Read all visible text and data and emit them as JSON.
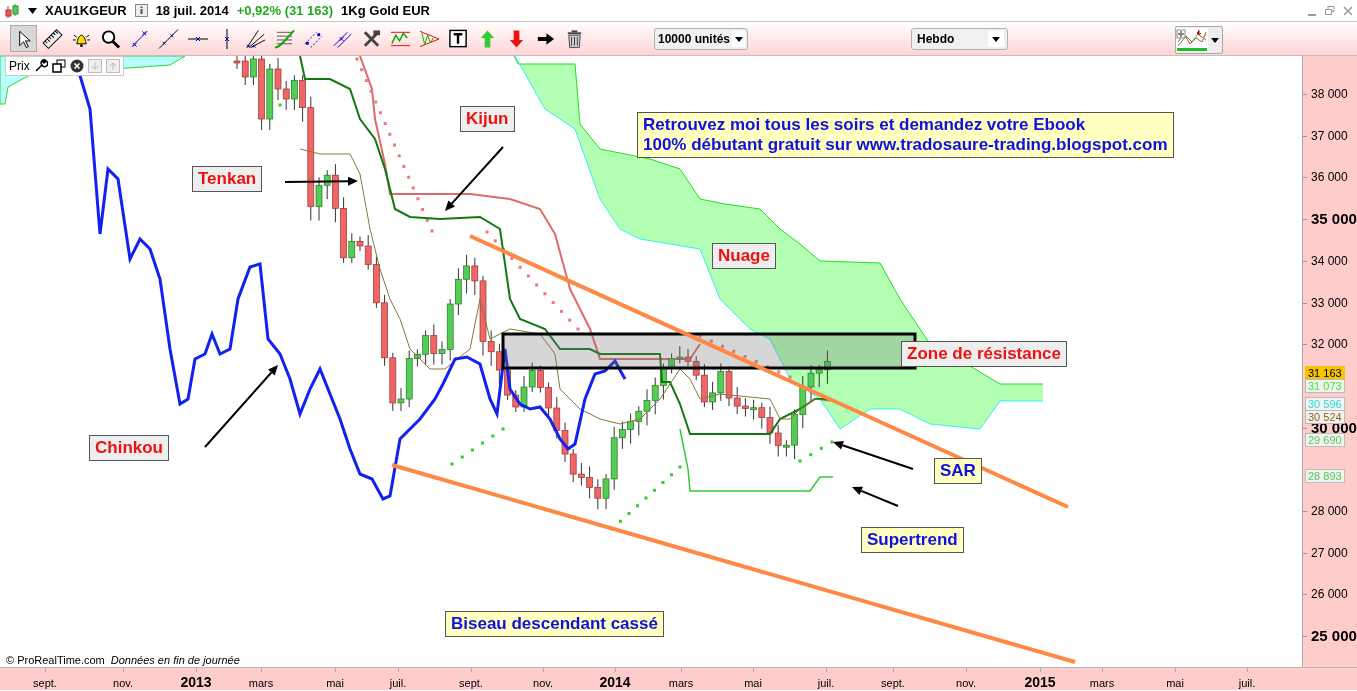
{
  "title_bar": {
    "symbol": "XAU1KGEUR",
    "date": "18 juil. 2014",
    "change": "+0,92% (31 163)",
    "name": "1Kg Gold EUR"
  },
  "toolbar": {
    "tools": [
      {
        "kind": "pointer",
        "selected": true
      },
      {
        "kind": "ruler",
        "selected": false
      },
      {
        "kind": "alarm",
        "selected": false
      },
      {
        "kind": "zoom",
        "selected": false
      },
      {
        "kind": "segment",
        "selected": false
      },
      {
        "kind": "line",
        "selected": false
      },
      {
        "kind": "hline",
        "selected": false
      },
      {
        "kind": "vline",
        "selected": false
      },
      {
        "kind": "fan",
        "selected": false
      },
      {
        "kind": "fibo",
        "selected": false
      },
      {
        "kind": "channel",
        "selected": false
      },
      {
        "kind": "parallel",
        "selected": false
      },
      {
        "kind": "tools",
        "selected": false
      },
      {
        "kind": "wave",
        "selected": false
      },
      {
        "kind": "triangle",
        "selected": false
      },
      {
        "kind": "text",
        "selected": false
      },
      {
        "kind": "up",
        "selected": false
      },
      {
        "kind": "down",
        "selected": false
      },
      {
        "kind": "right",
        "selected": false
      },
      {
        "kind": "trash",
        "selected": false
      }
    ],
    "units": "10000 unités",
    "period": "Hebdo"
  },
  "price_panel": {
    "label": "Prix"
  },
  "annotations": [
    {
      "kind": "label",
      "text": "Tenkan"
    },
    {
      "kind": "label",
      "text": "Kijun"
    },
    {
      "kind": "note",
      "text": "Retrouvez moi tous les soirs et demandez votre Ebook\n100% débutant gratuit sur www.tradosaure-trading.blogspot.com"
    },
    {
      "kind": "label",
      "text": "Nuage"
    },
    {
      "kind": "label",
      "text": "Zone de résistance"
    },
    {
      "kind": "label",
      "text": "Chinkou"
    },
    {
      "kind": "note",
      "text": "SAR"
    },
    {
      "kind": "note",
      "text": "Supertrend"
    },
    {
      "kind": "note",
      "text": "Biseau descendant cassé"
    }
  ],
  "y_axis": {
    "ticks": [
      {
        "label": "38 000",
        "kind": "minor"
      },
      {
        "label": "37 000",
        "kind": "minor"
      },
      {
        "label": "36 000",
        "kind": "minor"
      },
      {
        "label": "35 000",
        "kind": "major"
      },
      {
        "label": "34 000",
        "kind": "minor"
      },
      {
        "label": "33 000",
        "kind": "minor"
      },
      {
        "label": "32 000",
        "kind": "minor"
      },
      {
        "label": "30 000",
        "kind": "major"
      },
      {
        "label": "28 000",
        "kind": "minor"
      },
      {
        "label": "27 000",
        "kind": "minor"
      },
      {
        "label": "26 000",
        "kind": "minor"
      },
      {
        "label": "25 000",
        "kind": "major"
      }
    ]
  },
  "price_tags": [
    {
      "text": "31 163",
      "kind": "last",
      "color": "#f5c400"
    },
    {
      "text": "31 073",
      "kind": "indicator",
      "color": "#33ee33"
    },
    {
      "text": "30 596",
      "kind": "indicator",
      "color": "#22dddd"
    },
    {
      "text": "30 524",
      "kind": "indicator",
      "color": "#886622"
    },
    {
      "text": "29 690",
      "kind": "indicator",
      "color": "#55cc55"
    },
    {
      "text": "28 893",
      "kind": "indicator",
      "color": "#55cc55"
    }
  ],
  "x_axis": {
    "labels": [
      {
        "text": "sept.",
        "kind": "month"
      },
      {
        "text": "nov.",
        "kind": "month"
      },
      {
        "text": "2013",
        "kind": "year"
      },
      {
        "text": "mars",
        "kind": "month"
      },
      {
        "text": "mai",
        "kind": "month"
      },
      {
        "text": "juil.",
        "kind": "month"
      },
      {
        "text": "sept.",
        "kind": "month"
      },
      {
        "text": "nov.",
        "kind": "month"
      },
      {
        "text": "2014",
        "kind": "year"
      },
      {
        "text": "mars",
        "kind": "month"
      },
      {
        "text": "mai",
        "kind": "month"
      },
      {
        "text": "juil.",
        "kind": "month"
      },
      {
        "text": "sept.",
        "kind": "month"
      },
      {
        "text": "nov.",
        "kind": "month"
      },
      {
        "text": "2015",
        "kind": "year"
      },
      {
        "text": "mars",
        "kind": "month"
      },
      {
        "text": "mai",
        "kind": "month"
      },
      {
        "text": "juil.",
        "kind": "month"
      }
    ]
  },
  "footer": {
    "copyright": "© ProRealTime.com",
    "note": "Données en fin de journée"
  }
}
